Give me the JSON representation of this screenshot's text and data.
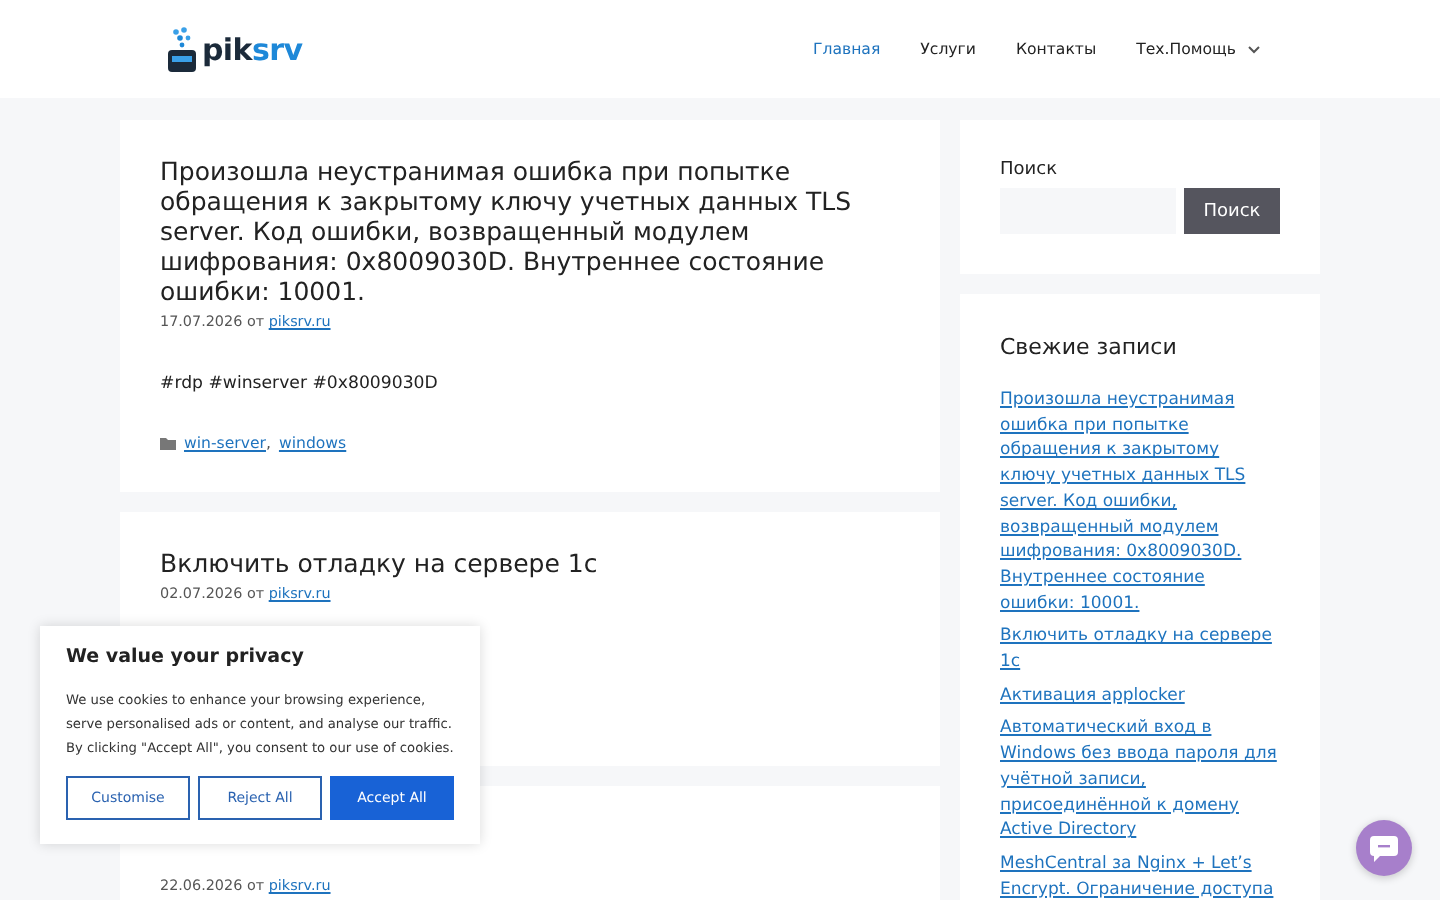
{
  "header": {
    "logo": {
      "text_main": "pik",
      "text_accent": "srv"
    },
    "nav": [
      {
        "label": "Главная",
        "selected": true,
        "has_submenu": false
      },
      {
        "label": "Услуги",
        "selected": false,
        "has_submenu": false
      },
      {
        "label": "Контакты",
        "selected": false,
        "has_submenu": false
      },
      {
        "label": "Тех.Помощь",
        "selected": false,
        "has_submenu": true
      }
    ]
  },
  "posts": [
    {
      "title": "Произошла неустранимая ошибка при попытке обращения к закрытому ключу учетных данных TLS server. Код ошибки, возвращенный модулем шифрования: 0x8009030D. Внутреннее состояние ошибки: 10001.",
      "date": "17.07.2026",
      "by": "от",
      "author": "piksrv.ru",
      "excerpt": "#rdp #winserver #0x8009030D",
      "categories": [
        "win-server",
        "windows"
      ],
      "category_separator": ","
    },
    {
      "title": "Включить отладку на сервере 1с",
      "date": "02.07.2026",
      "by": "от",
      "author": "piksrv.ru"
    },
    {
      "date": "22.06.2026",
      "by": "от",
      "author": "piksrv.ru"
    }
  ],
  "sidebar": {
    "search": {
      "label": "Поиск",
      "button": "Поиск"
    },
    "recent": {
      "title": "Свежие записи",
      "items": [
        "Произошла неустранимая ошибка при попытке обращения к закрытому ключу учетных данных TLS server. Код ошибки, возвращенный модулем шифрования: 0x8009030D. Внутреннее состояние ошибки: 10001.",
        "Включить отладку на сервере 1с",
        "Активация applocker",
        "Автоматический вход в Windows без ввода пароля для учётной записи, присоединённой к домену Active Directory",
        "MeshCentral за Nginx + Let’s Encrypt. Ограничение доступа"
      ]
    }
  },
  "cookie_banner": {
    "title": "We value your privacy",
    "text": "We use cookies to enhance your browsing experience, serve personalised ads or content, and analyse our traffic. By clicking \"Accept All\", you consent to our use of cookies.",
    "buttons": [
      {
        "label": "Customise",
        "kind": "outline"
      },
      {
        "label": "Reject All",
        "kind": "outline"
      },
      {
        "label": "Accept All",
        "kind": "primary"
      }
    ]
  }
}
